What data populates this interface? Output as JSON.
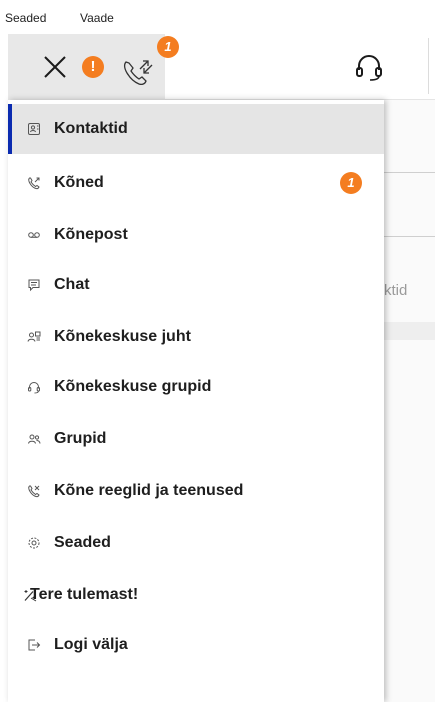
{
  "menubar": {
    "items": [
      "Seaded",
      "Vaade"
    ]
  },
  "toolbar": {
    "warning_badge": "!",
    "call_badge": "1"
  },
  "background": {
    "partial_text": "ktid"
  },
  "menu": {
    "items": [
      {
        "label": "Kontaktid",
        "icon": "contact-card-icon",
        "active": true
      },
      {
        "label": "Kõned",
        "icon": "phone-icon",
        "badge": "1"
      },
      {
        "label": "Kõnepost",
        "icon": "voicemail-icon"
      },
      {
        "label": "Chat",
        "icon": "chat-icon"
      },
      {
        "label": "Kõnekeskuse juht",
        "icon": "manager-icon"
      },
      {
        "label": "Kõnekeskuse grupid",
        "icon": "headset-icon"
      },
      {
        "label": "Grupid",
        "icon": "group-icon"
      },
      {
        "label": "Kõne reeglid ja teenused",
        "icon": "call-rules-icon"
      },
      {
        "label": "Seaded",
        "icon": "gear-icon"
      },
      {
        "label": "Tere tulemast!",
        "icon": "magic-wand-icon"
      },
      {
        "label": "Logi välja",
        "icon": "logout-icon"
      }
    ]
  },
  "colors": {
    "accent": "#0b2bb0",
    "badge": "#f47d20",
    "active_bg": "#e5e5e5"
  }
}
